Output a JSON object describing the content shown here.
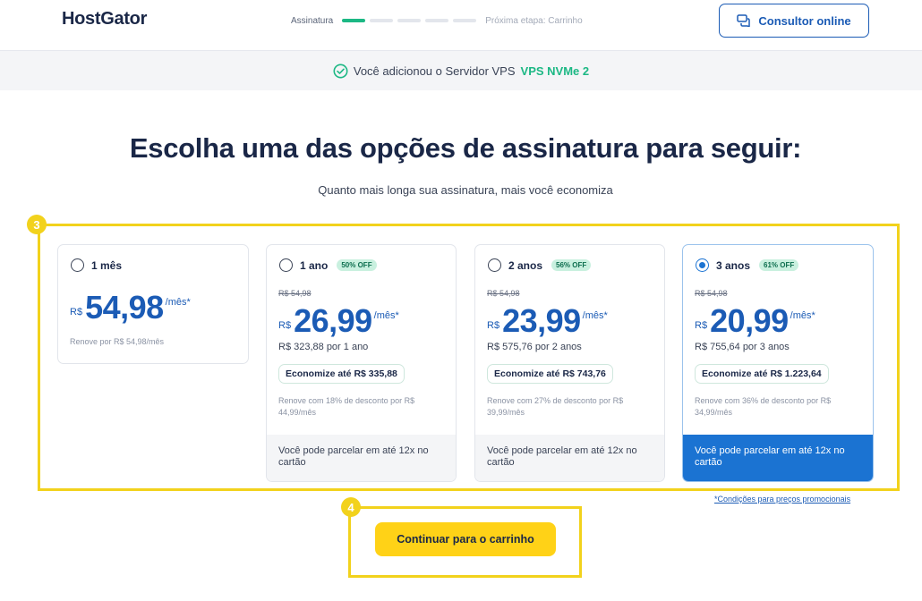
{
  "header": {
    "logo": "HostGator",
    "step_current": "Assinatura",
    "step_next": "Próxima etapa: Carrinho",
    "consult_label": "Consultor online"
  },
  "notice": {
    "prefix": "Você adicionou o Servidor VPS",
    "plan": "VPS NVMe 2"
  },
  "main": {
    "title": "Escolha uma das opções de assinatura para seguir:",
    "subtitle": "Quanto mais longa sua assinatura, mais você economiza"
  },
  "annotations": {
    "badge_plans": "3",
    "badge_cta": "4"
  },
  "plans": [
    {
      "term": "1 mês",
      "currency": "R$",
      "price": "54,98",
      "per": "/mês*",
      "renew": "Renove por R$ 54,98/mês",
      "selected": false
    },
    {
      "term": "1 ano",
      "off": "50% OFF",
      "old_price": "R$ 54,98",
      "currency": "R$",
      "price": "26,99",
      "per": "/mês*",
      "total": "R$ 323,88 por 1 ano",
      "save": "Economize até R$ 335,88",
      "renew": "Renove com 18% de desconto por R$ 44,99/mês",
      "installments": "Você pode parcelar em até 12x no cartão",
      "selected": false
    },
    {
      "term": "2 anos",
      "off": "56% OFF",
      "old_price": "R$ 54,98",
      "currency": "R$",
      "price": "23,99",
      "per": "/mês*",
      "total": "R$ 575,76 por 2 anos",
      "save": "Economize até R$ 743,76",
      "renew": "Renove com 27% de desconto por R$ 39,99/mês",
      "installments": "Você pode parcelar em até 12x no cartão",
      "selected": false
    },
    {
      "term": "3 anos",
      "off": "61% OFF",
      "old_price": "R$ 54,98",
      "currency": "R$",
      "price": "20,99",
      "per": "/mês*",
      "total": "R$ 755,64 por 3 anos",
      "save": "Economize até R$ 1.223,64",
      "renew": "Renove com 36% de desconto por R$ 34,99/mês",
      "installments": "Você pode parcelar em até 12x no cartão",
      "selected": true
    }
  ],
  "conditions_link": "*Condições para preços promocionais",
  "cta_label": "Continuar para o carrinho",
  "colors": {
    "brand_blue": "#1b5bb5",
    "selected_blue": "#1b73d2",
    "success_green": "#1cb884",
    "cta_yellow": "#ffd217",
    "highlight_yellow": "#f2d21c"
  },
  "icons": {
    "consult": "chat-bubbles-icon",
    "notice": "check-circle-icon"
  }
}
